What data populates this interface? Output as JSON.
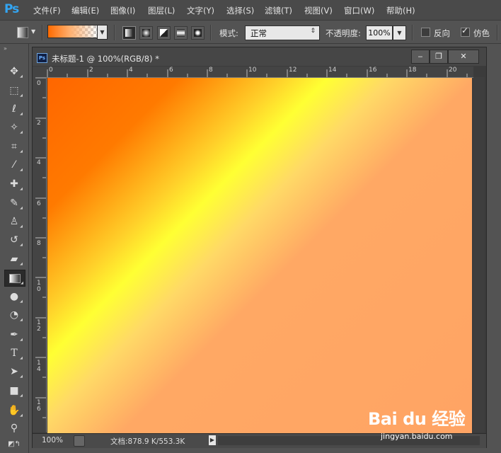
{
  "app": {
    "logo": "Ps"
  },
  "menu": [
    {
      "id": "file",
      "label": "文件(F)"
    },
    {
      "id": "edit",
      "label": "编辑(E)"
    },
    {
      "id": "image",
      "label": "图像(I)"
    },
    {
      "id": "layer",
      "label": "图层(L)"
    },
    {
      "id": "type",
      "label": "文字(Y)"
    },
    {
      "id": "select",
      "label": "选择(S)"
    },
    {
      "id": "filter",
      "label": "滤镜(T)"
    },
    {
      "id": "view",
      "label": "视图(V)"
    },
    {
      "id": "window",
      "label": "窗口(W)"
    },
    {
      "id": "help",
      "label": "帮助(H)"
    }
  ],
  "options": {
    "mode_label": "模式:",
    "mode_value": "正常",
    "opacity_label": "不透明度:",
    "opacity_value": "100%",
    "reverse_label": "反向",
    "reverse_checked": false,
    "dither_label": "仿色",
    "dither_checked": true,
    "gradient_colors": [
      "#ff6a00",
      "#ffb070",
      "transparent"
    ],
    "gradient_types": [
      "linear-gradient-icon",
      "radial-gradient-icon",
      "angle-gradient-icon",
      "reflected-gradient-icon",
      "diamond-gradient-icon"
    ],
    "active_gradient_type": "linear-gradient-icon"
  },
  "tools": [
    {
      "name": "move-tool-icon",
      "glyph": "▸✥"
    },
    {
      "name": "marquee-tool-icon",
      "glyph": "⬚"
    },
    {
      "name": "lasso-tool-icon",
      "glyph": "ℓ"
    },
    {
      "name": "magic-wand-tool-icon",
      "glyph": "✧"
    },
    {
      "name": "crop-tool-icon",
      "glyph": "⌗"
    },
    {
      "name": "eyedropper-tool-icon",
      "glyph": "⁄"
    },
    {
      "name": "healing-brush-tool-icon",
      "glyph": "✚"
    },
    {
      "name": "brush-tool-icon",
      "glyph": "✎"
    },
    {
      "name": "clone-stamp-tool-icon",
      "glyph": "♙"
    },
    {
      "name": "history-brush-tool-icon",
      "glyph": "↺"
    },
    {
      "name": "eraser-tool-icon",
      "glyph": "▰"
    },
    {
      "name": "gradient-tool-icon",
      "glyph": "▭"
    },
    {
      "name": "blur-tool-icon",
      "glyph": "●"
    },
    {
      "name": "dodge-tool-icon",
      "glyph": "◔"
    },
    {
      "name": "pen-tool-icon",
      "glyph": "✒"
    },
    {
      "name": "type-tool-icon",
      "glyph": "T"
    },
    {
      "name": "path-selection-tool-icon",
      "glyph": "➤"
    },
    {
      "name": "rectangle-tool-icon",
      "glyph": "■"
    },
    {
      "name": "hand-tool-icon",
      "glyph": "✋"
    },
    {
      "name": "zoom-tool-icon",
      "glyph": "⚲"
    }
  ],
  "document": {
    "title": "未标题-1 @ 100%(RGB/8) *",
    "ruler_top_labels": [
      "0",
      "2",
      "4",
      "6",
      "8",
      "10",
      "12",
      "14",
      "16",
      "18",
      "20"
    ],
    "ruler_left_labels": [
      "0",
      "2",
      "4",
      "6",
      "8",
      "1 0",
      "1 2",
      "1 4",
      "1 6"
    ],
    "zoom": "100%",
    "doc_size": "文档:878.9 K/553.3K"
  },
  "watermark": {
    "brand": "Bai du 经验",
    "url": "jingyan.baidu.com"
  }
}
